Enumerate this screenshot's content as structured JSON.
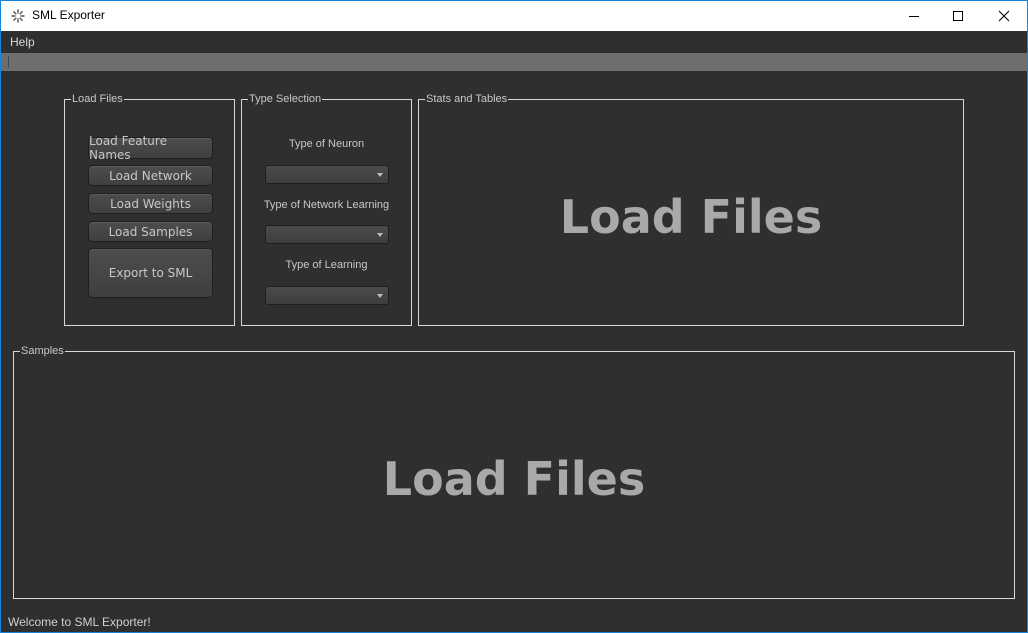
{
  "window": {
    "title": "SML Exporter",
    "controls": {
      "minimize": "minimize-icon",
      "maximize": "maximize-icon",
      "close": "close-icon"
    }
  },
  "menu": {
    "help": "Help"
  },
  "load_files_group": {
    "title": "Load Files",
    "buttons": {
      "feature_names": "Load Feature Names",
      "network": "Load Network",
      "weights": "Load Weights",
      "samples": "Load Samples",
      "export": "Export to SML"
    }
  },
  "type_selection_group": {
    "title": "Type Selection",
    "neuron_label": "Type of Neuron",
    "network_learning_label": "Type of Network Learning",
    "learning_label": "Type of Learning"
  },
  "stats_group": {
    "title": "Stats and Tables",
    "placeholder": "Load Files"
  },
  "samples_group": {
    "title": "Samples",
    "placeholder": "Load Files"
  },
  "status_bar": {
    "message": "Welcome to SML Exporter!"
  },
  "colors": {
    "background": "#2f2f2f",
    "window_border": "#1883d7",
    "toolbar": "#6e6e6e",
    "placeholder_text": "#a9a9a9"
  }
}
